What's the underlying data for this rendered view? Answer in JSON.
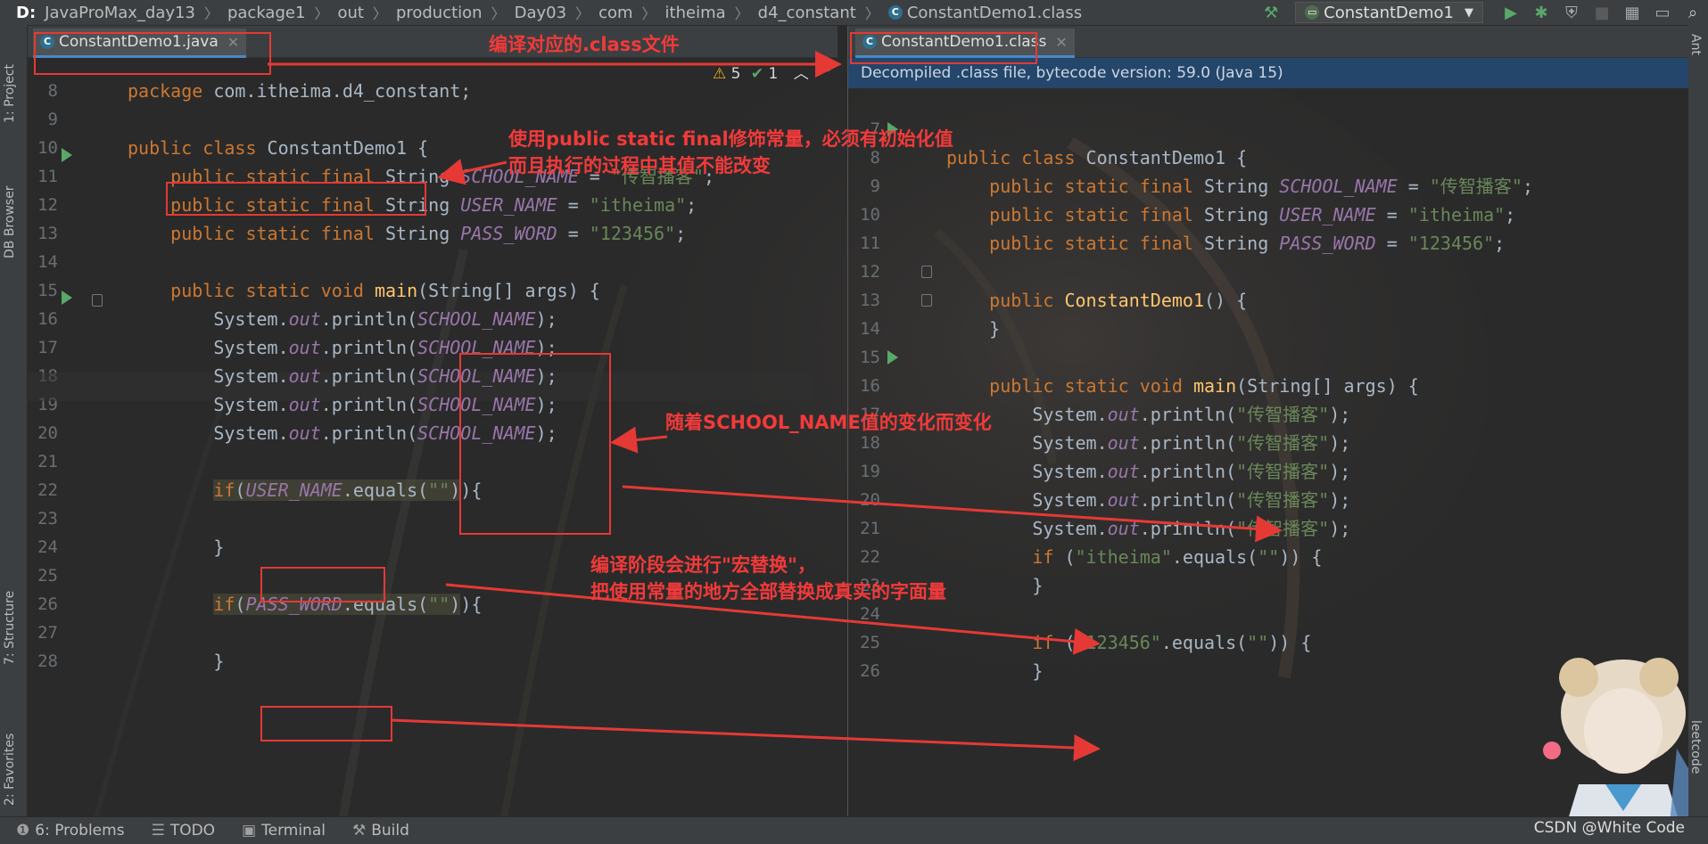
{
  "breadcrumb": {
    "drive": "D:",
    "items": [
      "JavaProMax_day13",
      "package1",
      "out",
      "production",
      "Day03",
      "com",
      "itheima",
      "d4_constant",
      "ConstantDemo1.class"
    ]
  },
  "toolbar": {
    "run_config": "ConstantDemo1"
  },
  "left_tools": {
    "project": "1: Project",
    "db_browser": "DB Browser",
    "structure": "7: Structure",
    "favorites": "2: Favorites"
  },
  "right_tools": {
    "ant": "Ant",
    "leetcode": "leetcode"
  },
  "left_editor": {
    "tab": "ConstantDemo1.java",
    "inspection": {
      "warnings": "5",
      "ok": "1"
    },
    "line_numbers": [
      "8",
      "9",
      "10",
      "11",
      "12",
      "13",
      "14",
      "15",
      "16",
      "17",
      "18",
      "19",
      "20",
      "21",
      "22",
      "23",
      "24",
      "25",
      "26",
      "27",
      "28"
    ]
  },
  "right_editor": {
    "tab": "ConstantDemo1.class",
    "banner": "Decompiled .class file, bytecode version: 59.0 (Java 15)",
    "line_numbers": [
      "7",
      "8",
      "9",
      "10",
      "11",
      "12",
      "13",
      "14",
      "15",
      "16",
      "17",
      "18",
      "19",
      "20",
      "21",
      "22",
      "23",
      "24",
      "25",
      "26"
    ]
  },
  "annotations": {
    "compile": "编译对应的.class文件",
    "modifier_1": "使用public static final修饰常量，必须有初始化值",
    "modifier_2": "而且执行的过程中其值不能改变",
    "follow": "随着SCHOOL_NAME值的变化而变化",
    "macro_1": "编译阶段会进行\"宏替换\"，",
    "macro_2": "把使用常量的地方全部替换成真实的字面量"
  },
  "bottom_tabs": {
    "problems": "6: Problems",
    "todo": "TODO",
    "terminal": "Terminal",
    "build": "Build"
  },
  "watermark": "CSDN @White Code",
  "colors": {
    "keyword": "#cc7832",
    "field": "#9876aa",
    "string": "#6a8759",
    "method": "#ffc66d",
    "annotation": "#e53935"
  }
}
